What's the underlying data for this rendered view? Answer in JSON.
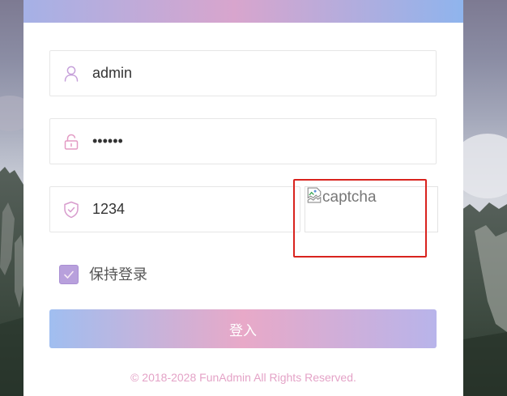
{
  "form": {
    "username": {
      "icon": "user-icon",
      "value": "admin"
    },
    "password": {
      "icon": "lock-icon",
      "value": "••••••"
    },
    "captcha": {
      "icon": "shield-icon",
      "value": "1234",
      "image_icon": "broken-image-icon",
      "image_alt": "captcha"
    },
    "remember": {
      "label": "保持登录",
      "checked": true
    },
    "submit": {
      "label": "登入"
    }
  },
  "footer": {
    "copyright": "© 2018-2028 FunAdmin All Rights Reserved."
  },
  "colors": {
    "header_gradient": [
      "#a5b1e6",
      "#d8a5cd",
      "#8fb4ed"
    ],
    "button_gradient": [
      "#a0bef0",
      "#e8a9c8",
      "#b8b4ea"
    ],
    "icon_user": "#c6a0da",
    "icon_lock": "#e39bc4",
    "icon_shield": "#d89ccd",
    "checkbox_fill": "#b8a0dc",
    "footer_text": "#e4a3c7",
    "highlight": "#d9231e"
  }
}
